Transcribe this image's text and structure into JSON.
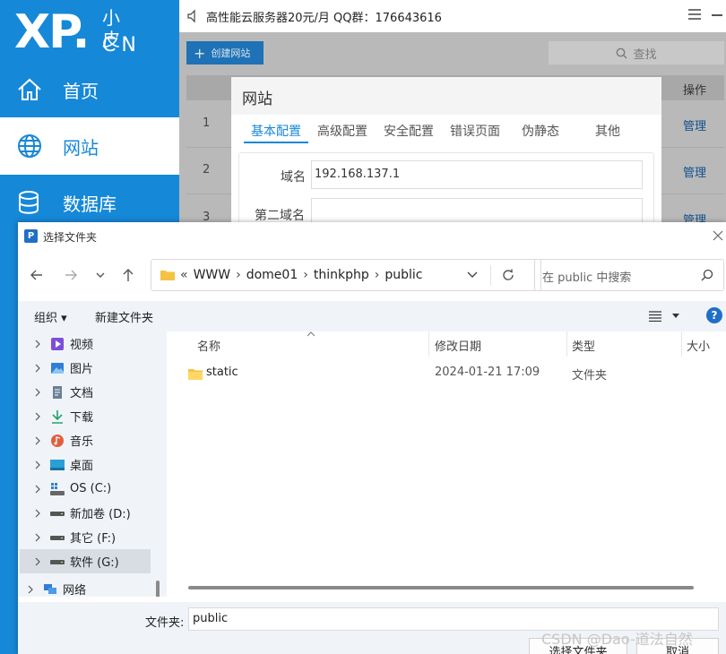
{
  "app": {
    "logo_big": "XP.",
    "logo_small": "小皮",
    "logo_cn": "CN",
    "topbar_text": "高性能云服务器20元/月  QQ群：176643616",
    "nav": [
      {
        "label": "首页",
        "icon": "home-icon"
      },
      {
        "label": "网站",
        "icon": "globe-icon",
        "active": true
      },
      {
        "label": "数据库",
        "icon": "database-icon"
      }
    ],
    "create_btn": "创建网站",
    "search_placeholder": "查找",
    "table_op_header": "操作",
    "rows": [
      {
        "num": "1",
        "action": "管理"
      },
      {
        "num": "2",
        "action": "管理"
      },
      {
        "num": "3",
        "action": "管理"
      }
    ]
  },
  "site_modal": {
    "title": "网站",
    "tabs": [
      "基本配置",
      "高级配置",
      "安全配置",
      "错误页面",
      "伪静态",
      "其他"
    ],
    "active_tab": "基本配置",
    "domain_label": "域名",
    "domain_value": "192.168.137.1",
    "second_domain_label": "第二域名",
    "second_domain_value": ""
  },
  "dialog": {
    "title": "选择文件夹",
    "breadcrumb_prefix": "«",
    "breadcrumb": [
      "WWW",
      "dome01",
      "thinkphp",
      "public"
    ],
    "search_placeholder": "在 public 中搜索",
    "organize": "组织 ▾",
    "new_folder": "新建文件夹",
    "help": "?",
    "tree": [
      {
        "label": "视频",
        "icon": "video-icon"
      },
      {
        "label": "图片",
        "icon": "pictures-icon"
      },
      {
        "label": "文档",
        "icon": "documents-icon"
      },
      {
        "label": "下载",
        "icon": "download-icon"
      },
      {
        "label": "音乐",
        "icon": "music-icon"
      },
      {
        "label": "桌面",
        "icon": "desktop-icon"
      },
      {
        "label": "OS (C:)",
        "icon": "drive-c-icon"
      },
      {
        "label": "新加卷 (D:)",
        "icon": "drive-icon"
      },
      {
        "label": "其它 (F:)",
        "icon": "drive-icon"
      },
      {
        "label": "软件 (G:)",
        "icon": "drive-icon",
        "selected": true
      },
      {
        "label": "网络",
        "icon": "network-icon"
      }
    ],
    "columns": {
      "name": "名称",
      "modified": "修改日期",
      "type": "类型",
      "size": "大小"
    },
    "files": [
      {
        "name": "static",
        "modified": "2024-01-21 17:09",
        "type": "文件夹",
        "size": ""
      }
    ],
    "folder_label": "文件夹:",
    "folder_value": "public",
    "select_btn": "选择文件夹",
    "cancel_btn": "取消"
  },
  "watermark": "CSDN @Dao-道法自然",
  "colors": {
    "brand_blue": "#1688d8",
    "accent": "#1f6fc8",
    "link": "#11518f"
  }
}
